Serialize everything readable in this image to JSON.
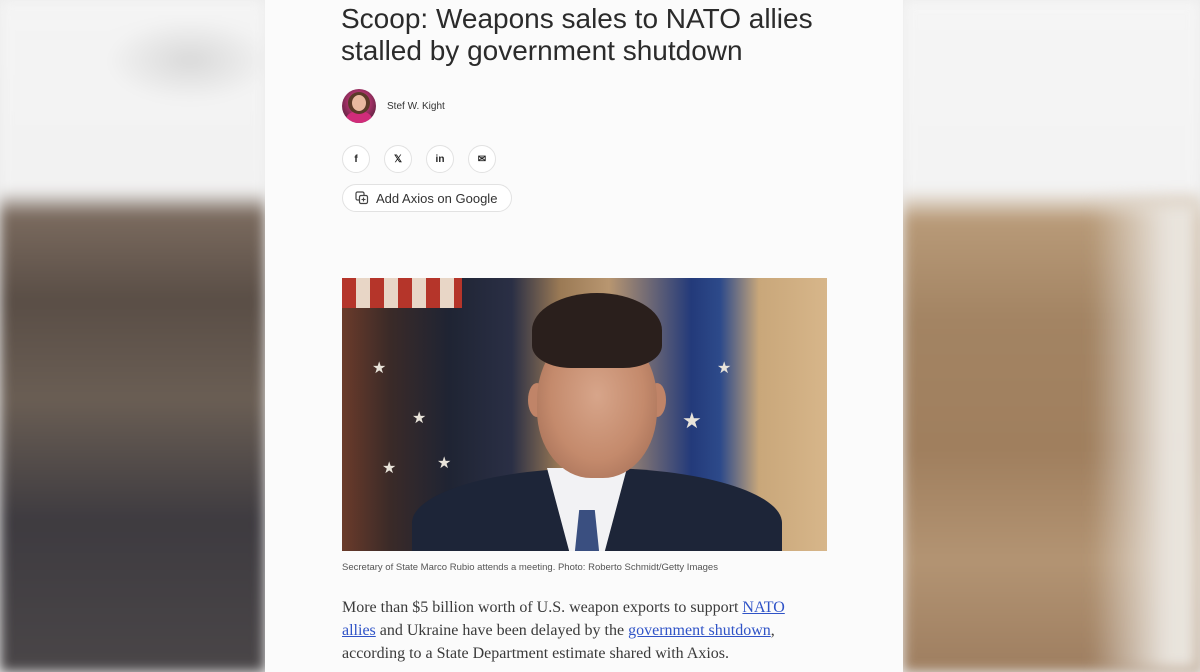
{
  "article": {
    "headline": "Scoop: Weapons sales to NATO allies stalled by government shutdown",
    "author": "Stef W. Kight",
    "share": {
      "facebook_icon": "f",
      "x_icon": "𝕏",
      "linkedin_icon": "in",
      "email_icon": "✉"
    },
    "add_google_label": "Add Axios on Google",
    "photo_caption": "Secretary of State Marco Rubio attends a meeting. Photo: Roberto Schmidt/Getty Images",
    "body": {
      "part1": "More than $5 billion worth of U.S. weapon exports to support ",
      "link1": "NATO allies",
      "part2": " and Ukraine have been delayed by the ",
      "link2": "government shutdown",
      "part3": ", according to a State Department estimate shared with Axios."
    }
  },
  "colors": {
    "link": "#2f53c7",
    "headline": "#2b2b2b"
  }
}
